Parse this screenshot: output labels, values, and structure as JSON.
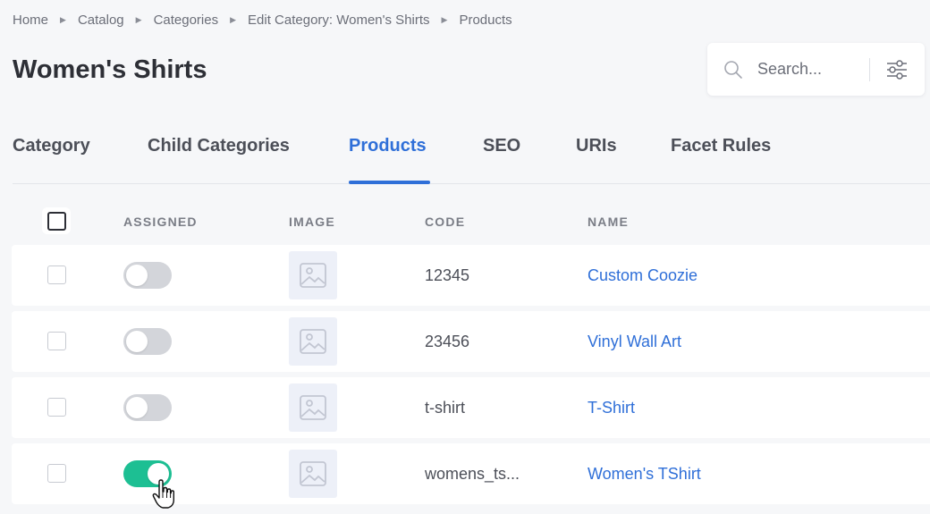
{
  "breadcrumb": [
    "Home",
    "Catalog",
    "Categories",
    "Edit Category: Women's Shirts",
    "Products"
  ],
  "page_title": "Women's Shirts",
  "search": {
    "placeholder": "Search..."
  },
  "tabs": [
    {
      "label": "Category",
      "active": false
    },
    {
      "label": "Child Categories",
      "active": false
    },
    {
      "label": "Products",
      "active": true
    },
    {
      "label": "SEO",
      "active": false
    },
    {
      "label": "URIs",
      "active": false
    },
    {
      "label": "Facet Rules",
      "active": false
    }
  ],
  "table": {
    "headers": {
      "assigned": "ASSIGNED",
      "image": "IMAGE",
      "code": "CODE",
      "name": "NAME"
    },
    "rows": [
      {
        "assigned": false,
        "code": "12345",
        "name": "Custom Coozie"
      },
      {
        "assigned": false,
        "code": "23456",
        "name": "Vinyl Wall Art"
      },
      {
        "assigned": false,
        "code": "t-shirt",
        "name": "T-Shirt"
      },
      {
        "assigned": true,
        "code": "womens_ts...",
        "name": "Women's TShirt"
      }
    ]
  },
  "colors": {
    "accent": "#2f6fd8",
    "toggle_on": "#1dbf93",
    "toggle_off": "#d3d5da",
    "background": "#f6f7f9"
  },
  "icons": [
    "chevron-right-icon",
    "search-icon",
    "sliders-icon",
    "image-placeholder-icon",
    "hand-pointer-cursor"
  ]
}
